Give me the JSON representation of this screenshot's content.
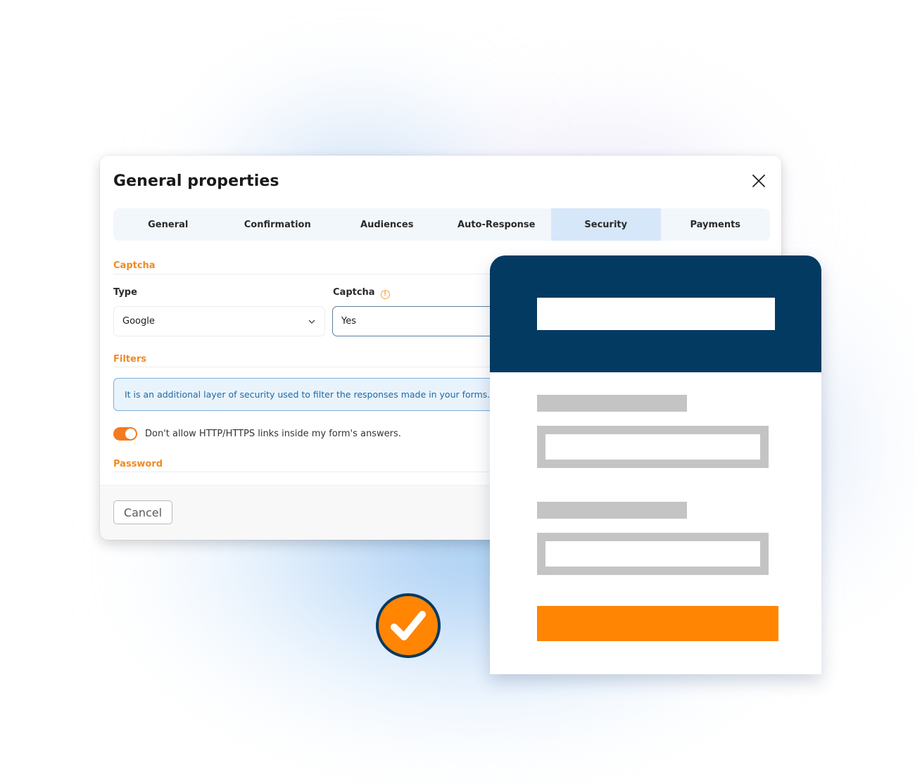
{
  "dialog": {
    "title": "General properties",
    "close_icon": "close-icon",
    "tabs": [
      {
        "label": "General",
        "active": false
      },
      {
        "label": "Confirmation",
        "active": false
      },
      {
        "label": "Audiences",
        "active": false
      },
      {
        "label": "Auto-Response",
        "active": false
      },
      {
        "label": "Security",
        "active": true
      },
      {
        "label": "Payments",
        "active": false
      }
    ],
    "sections": {
      "captcha": {
        "heading": "Captcha",
        "type_label": "Type",
        "type_value": "Google",
        "captcha_label": "Captcha",
        "captcha_info_icon": "info-icon",
        "captcha_value": "Yes"
      },
      "filters": {
        "heading": "Filters",
        "info_text": "It is an additional layer of security used to filter the responses made in your forms.",
        "toggle_label": "Don't allow HTTP/HTTPS links inside my form's answers.",
        "toggle_on": true
      },
      "password": {
        "heading": "Password"
      }
    },
    "footer": {
      "cancel_label": "Cancel"
    }
  },
  "illustration": {
    "form_card": "form-mockup",
    "badge_icon": "checkmark-icon"
  },
  "colors": {
    "accent_orange": "#f08a24",
    "toggle_orange": "#f37a21",
    "navy": "#033a62",
    "button_orange": "#ff8503",
    "active_tab": "#d6e7f9",
    "info_text": "#1c6aa6"
  }
}
